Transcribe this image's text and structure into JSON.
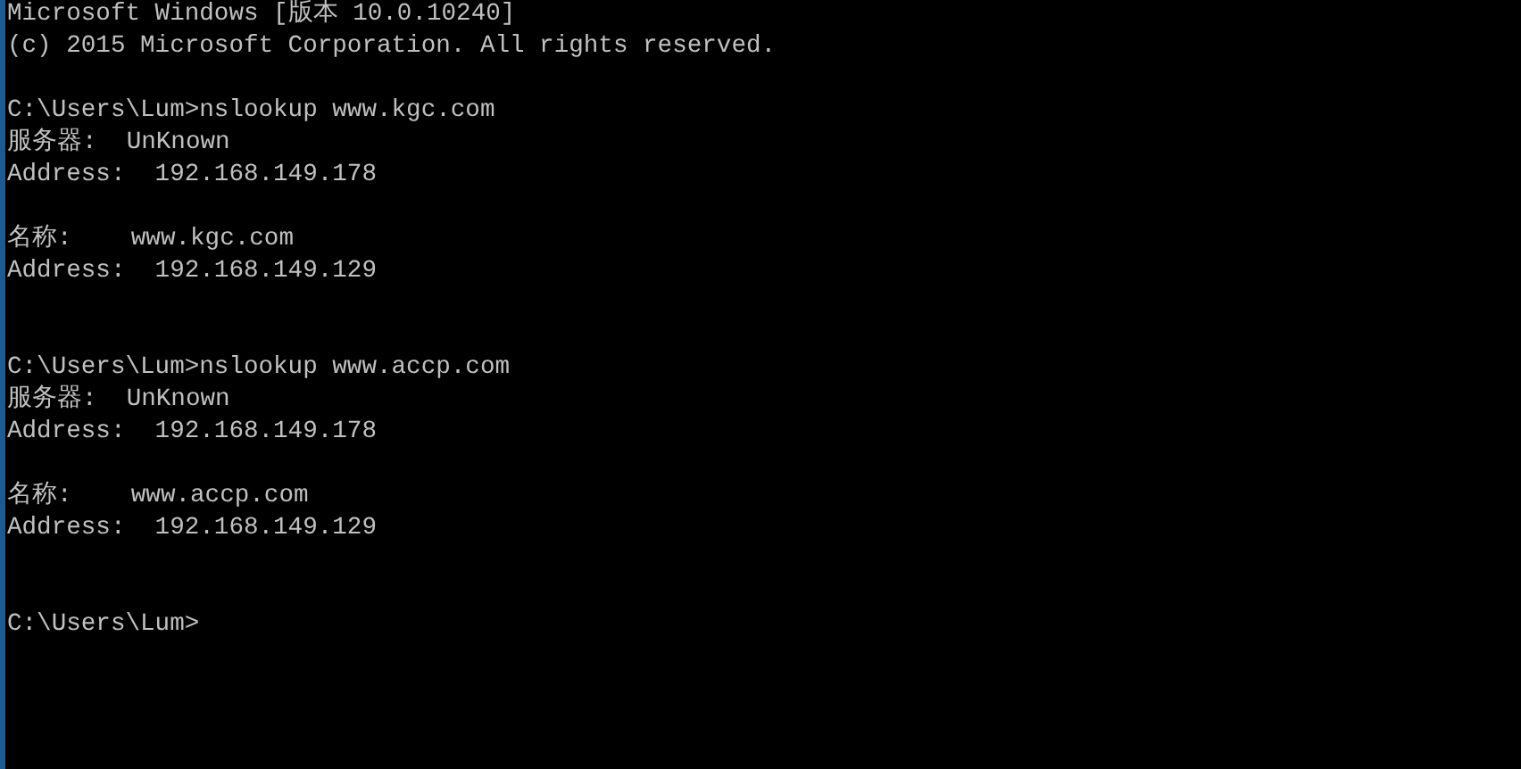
{
  "console": {
    "header": [
      "Microsoft Windows [版本 10.0.10240]",
      "(c) 2015 Microsoft Corporation. All rights reserved."
    ],
    "commands": [
      {
        "command_line": "C:\\Users\\Lum>nslookup www.kgc.com",
        "server": [
          "服务器:  UnKnown",
          "Address:  192.168.149.178"
        ],
        "answer": [
          "名称:    www.kgc.com",
          "Address:  192.168.149.129"
        ]
      },
      {
        "command_line": "C:\\Users\\Lum>nslookup www.accp.com",
        "server": [
          "服务器:  UnKnown",
          "Address:  192.168.149.178"
        ],
        "answer": [
          "名称:    www.accp.com",
          "Address:  192.168.149.129"
        ]
      }
    ],
    "prompt": "C:\\Users\\Lum>"
  }
}
